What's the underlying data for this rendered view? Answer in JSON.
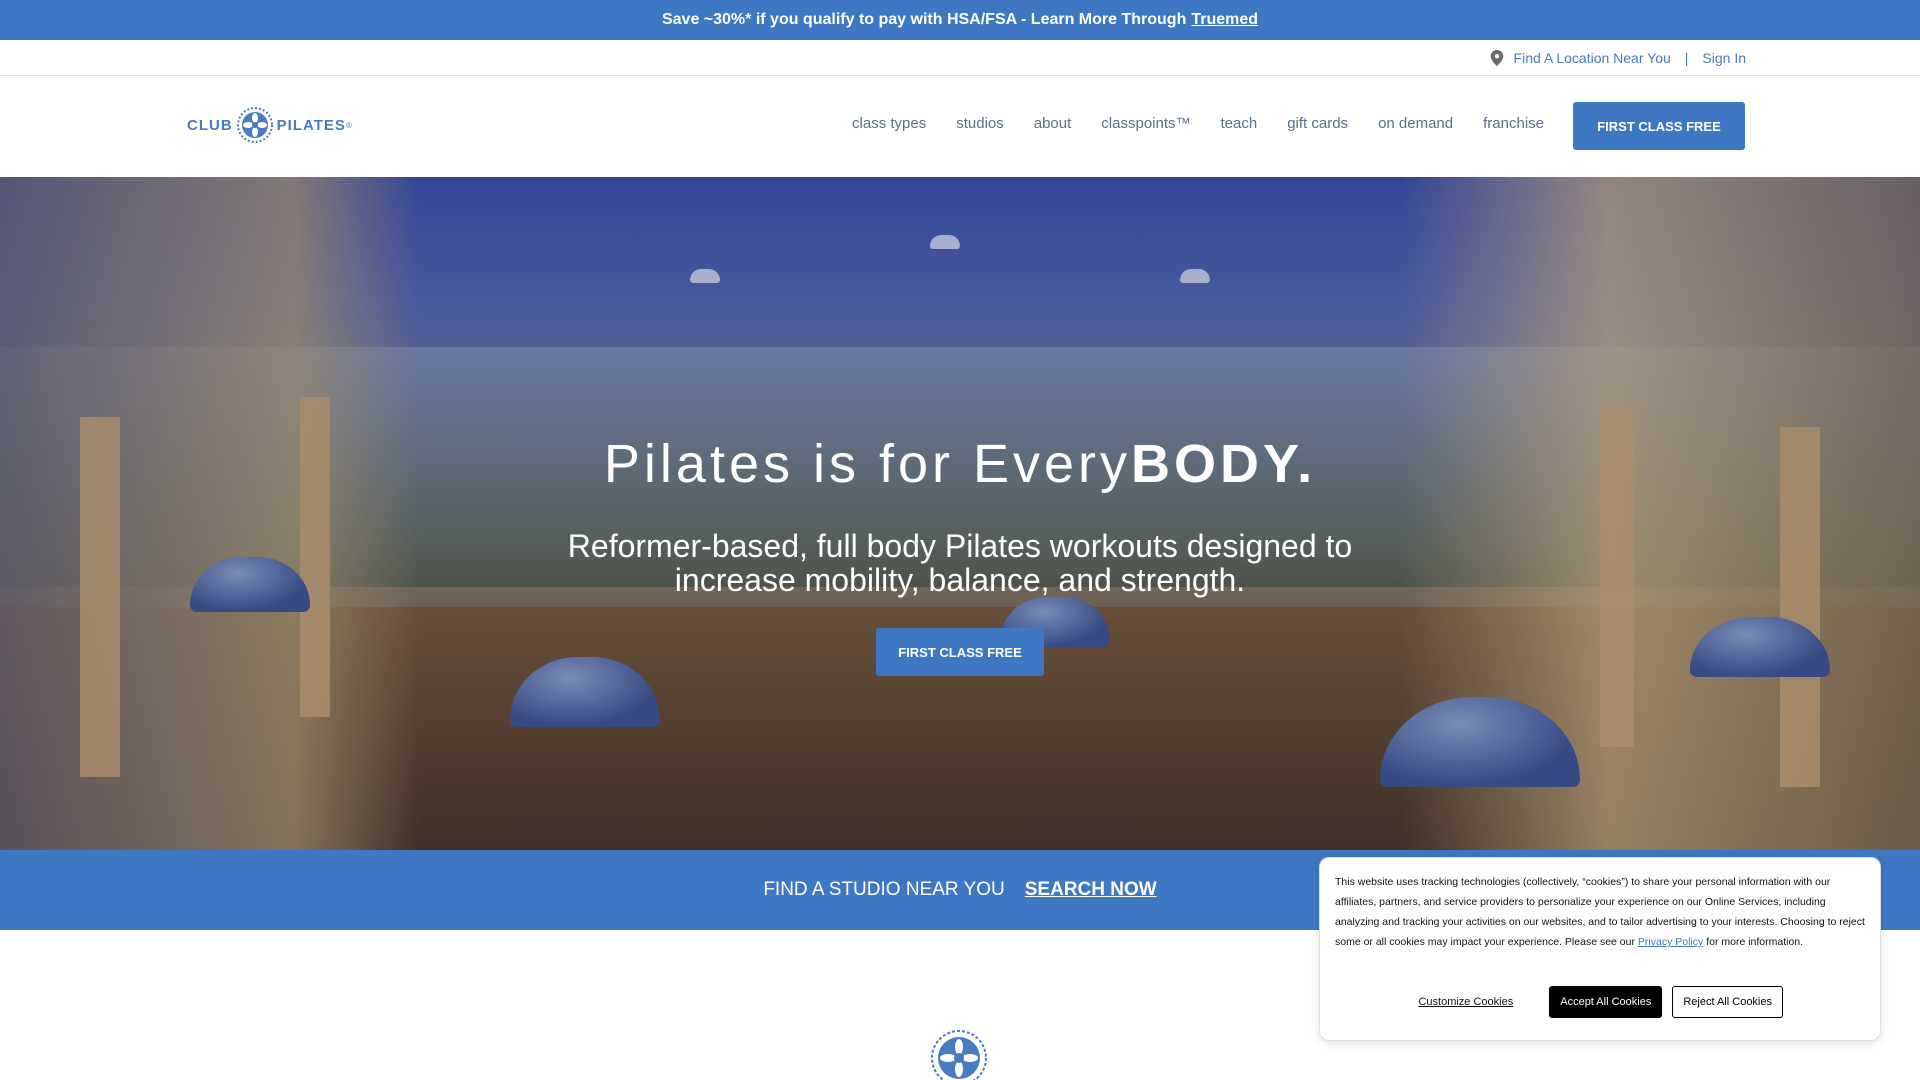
{
  "promo": {
    "text": "Save ~30%* if you qualify to pay with HSA/FSA - Learn More Through",
    "link": "Truemed"
  },
  "utility": {
    "location_icon": "map-pin-icon",
    "find_location": "Find A Location Near You",
    "separator": "|",
    "sign_in": "Sign In"
  },
  "header": {
    "logo_left": "CLUB",
    "logo_right": "PILATES",
    "logo_tm": "®",
    "nav": [
      "class types",
      "studios",
      "about",
      "classpoints™",
      "teach",
      "gift cards",
      "on demand",
      "franchise"
    ],
    "cta": "FIRST CLASS FREE"
  },
  "hero": {
    "title_light": "Pilates is for Every",
    "title_bold": "BODY.",
    "subtitle": "Reformer-based, full body Pilates workouts designed to increase mobility, balance, and strength.",
    "cta": "FIRST CLASS FREE"
  },
  "findbar": {
    "label": "FIND A STUDIO NEAR YOU",
    "link": "SEARCH NOW"
  },
  "cookie": {
    "text_before": "This website uses tracking technologies (collectively, “cookies”) to share your personal information with our affiliates, partners, and service providers to personalize your experience on our Online Services, including analyzing and tracking your activities on our websites, and to tailor advertising to your interests.  Choosing to reject some or all cookies may impact your experience. Please see our",
    "privacy_link": "Privacy Policy",
    "text_after": "for more information.",
    "customize": "Customize Cookies",
    "accept": "Accept All Cookies",
    "reject": "Reject All Cookies"
  },
  "colors": {
    "brand_blue": "#3f78c2",
    "nav_text": "#5a6f8a"
  }
}
